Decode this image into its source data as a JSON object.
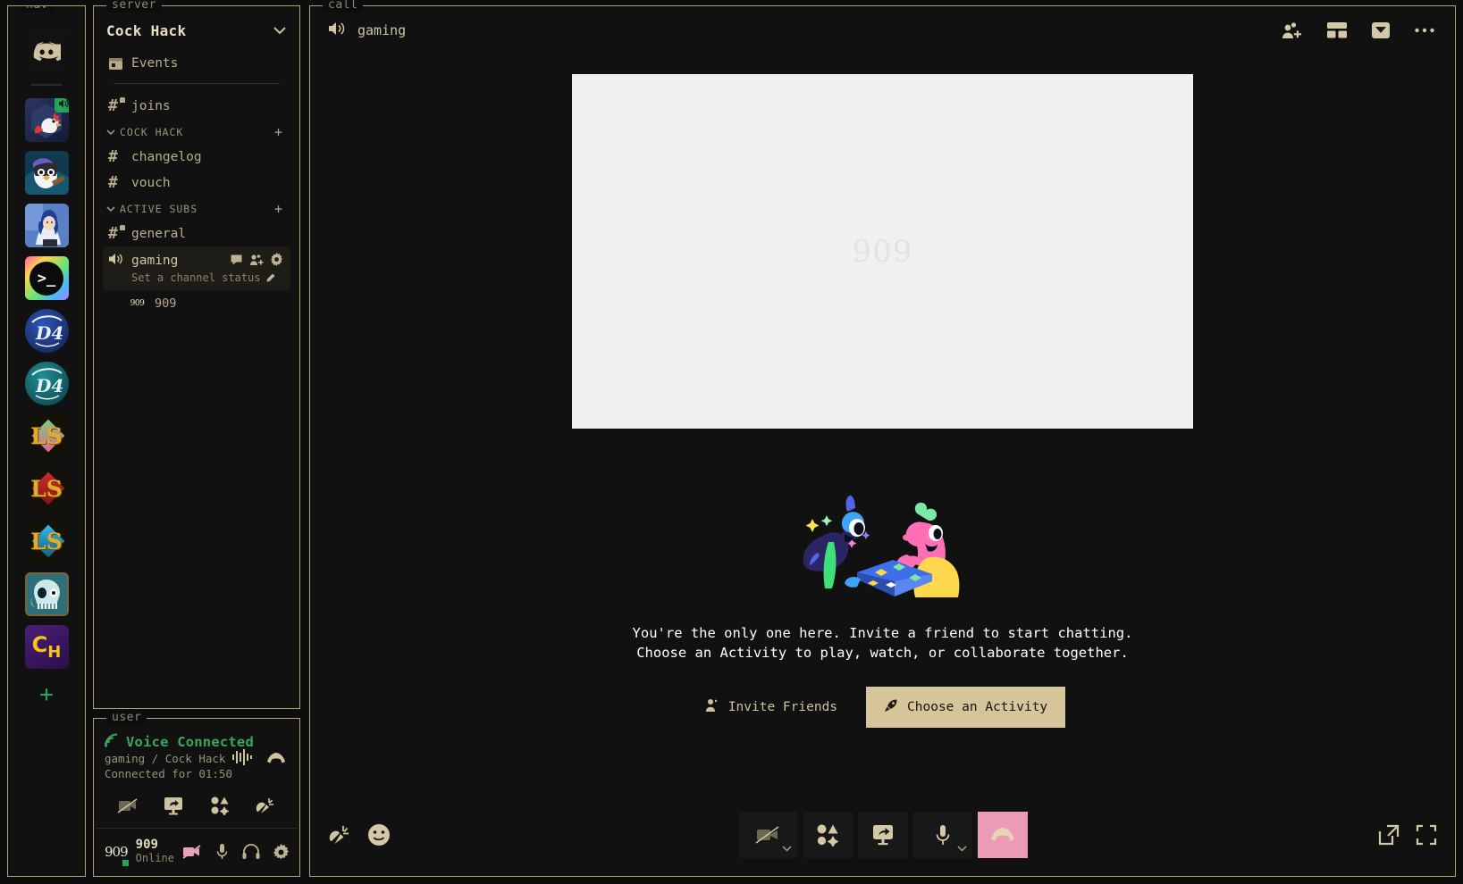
{
  "panels": {
    "nav_legend": "nav",
    "server_legend": "server",
    "user_legend": "user",
    "call_legend": "call"
  },
  "nav": {
    "items": [
      {
        "name": "discord-home",
        "label": "Discord",
        "kind": "discord"
      },
      {
        "name": "rooster-server",
        "label": "Cock Hack",
        "kind": "rooster",
        "active": true,
        "voice_badge": true
      },
      {
        "name": "penguin-server",
        "label": "Penguin",
        "kind": "penguin"
      },
      {
        "name": "anime-server",
        "label": "Anime",
        "kind": "anime"
      },
      {
        "name": "terminal-server",
        "label": "Terminal",
        "kind": "terminal",
        "glyph": ">_"
      },
      {
        "name": "d4-blue-server",
        "label": "D4",
        "kind": "d4a",
        "glyph": "D4"
      },
      {
        "name": "d4-teal-server",
        "label": "D4",
        "kind": "d4b",
        "glyph": "D4"
      },
      {
        "name": "ls-green-server",
        "label": "LS",
        "kind": "ls-green",
        "glyph": "LS"
      },
      {
        "name": "ls-red-server",
        "label": "LS",
        "kind": "ls-red",
        "glyph": "LS"
      },
      {
        "name": "ls-blue-server",
        "label": "LS",
        "kind": "ls-blue",
        "glyph": "LS"
      },
      {
        "name": "skull-server",
        "label": "Skull",
        "kind": "skull"
      },
      {
        "name": "ch-server",
        "label": "CH",
        "kind": "ch",
        "glyph": "CH"
      }
    ],
    "add_server_label": "+"
  },
  "server": {
    "title": "Cock Hack",
    "events_label": "Events",
    "top_channel": {
      "label": "joins",
      "locked": true
    },
    "categories": [
      {
        "label": "COCK HACK",
        "channels": [
          {
            "label": "changelog",
            "locked": false
          },
          {
            "label": "vouch",
            "locked": false
          }
        ]
      },
      {
        "label": "ACTIVE SUBS",
        "channels": [
          {
            "label": "general",
            "locked": true
          }
        ]
      }
    ],
    "voice_channel": {
      "label": "gaming",
      "status_placeholder": "Set a channel status",
      "active": true,
      "members": [
        {
          "name": "909",
          "avatar_text": "909"
        }
      ]
    },
    "add_channel_label": "+"
  },
  "user": {
    "voice_status_title": "Voice Connected",
    "voice_location": "gaming / Cock Hack",
    "voice_duration": "Connected for 01:50",
    "actions": [
      {
        "name": "camera-off-button"
      },
      {
        "name": "screen-share-button"
      },
      {
        "name": "activities-button"
      },
      {
        "name": "soundboard-button"
      }
    ],
    "profile": {
      "avatar_text": "909",
      "username": "909",
      "status": "Online"
    },
    "profile_icons": [
      {
        "name": "camera-disabled-icon"
      },
      {
        "name": "microphone-icon"
      },
      {
        "name": "headphones-icon"
      },
      {
        "name": "settings-gear-icon"
      }
    ]
  },
  "call": {
    "channel_name": "gaming",
    "header_icons": [
      {
        "name": "add-person-icon"
      },
      {
        "name": "grid-layout-icon"
      },
      {
        "name": "chat-panel-icon"
      },
      {
        "name": "more-options-icon"
      }
    ],
    "video_tile": {
      "watermark": "909"
    },
    "empty_state": {
      "line1": "You're the only one here. Invite a friend to start chatting.",
      "line2": "Choose an Activity to play, watch, or collaborate together.",
      "invite_button": "Invite Friends",
      "activity_button": "Choose an Activity"
    },
    "controls": {
      "left": [
        {
          "name": "soundboard-button"
        },
        {
          "name": "emoji-button"
        }
      ],
      "center": [
        {
          "name": "camera-toggle-button",
          "has_caret": true
        },
        {
          "name": "activities-button",
          "has_caret": false
        },
        {
          "name": "screen-share-button",
          "has_caret": false
        },
        {
          "name": "microphone-toggle-button",
          "has_caret": true
        },
        {
          "name": "disconnect-button",
          "has_caret": false
        }
      ],
      "right": [
        {
          "name": "popout-button"
        },
        {
          "name": "fullscreen-button"
        }
      ]
    }
  },
  "colors": {
    "accent": "#d6c49a",
    "border": "#b5a178",
    "background": "#0d0d0d",
    "panel": "#111111",
    "online_green": "#23a55a",
    "danger_pink": "#eb9bb8",
    "text": "#cfc5a4"
  }
}
